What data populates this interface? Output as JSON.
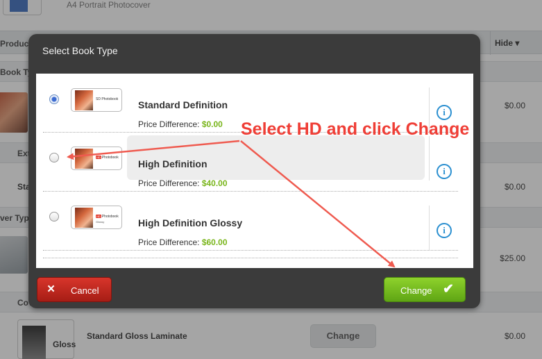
{
  "background": {
    "top_text": "A4 Portrait Photocover",
    "header_label": "Product O",
    "hide_label": "Hide",
    "book_type_label": "Book Typ",
    "ext_label": "Ext",
    "sta_label": "Sta",
    "cover_type_label": "ver Typ",
    "cov_label": "Cov",
    "gloss_text": "Gloss",
    "laminate_label": "Standard Gloss Laminate",
    "change_button": "Change",
    "prices": [
      "$0.00",
      "$0.00",
      "$25.00",
      "$0.00"
    ]
  },
  "modal": {
    "title": "Select Book Type",
    "price_prefix": "Price Difference: ",
    "options": [
      {
        "name": "Standard Definition",
        "price": "$0.00",
        "selected": true,
        "thumb_badge": "",
        "thumb_tag": "SD Photobook",
        "thumb_sub": ""
      },
      {
        "name": "High Definition",
        "price": "$40.00",
        "selected": false,
        "thumb_badge": "HD",
        "thumb_tag": "Photobook",
        "thumb_sub": ""
      },
      {
        "name": "High Definition Glossy",
        "price": "$60.00",
        "selected": false,
        "thumb_badge": "HD",
        "thumb_tag": "Photobook",
        "thumb_sub": "Glossy"
      }
    ],
    "info_glyph": "i",
    "cancel_label": "Cancel",
    "cancel_icon": "×",
    "change_label": "Change",
    "change_icon": "✔"
  },
  "annotation": {
    "text": "Select HD and click Change",
    "color": "#ef3e36"
  }
}
